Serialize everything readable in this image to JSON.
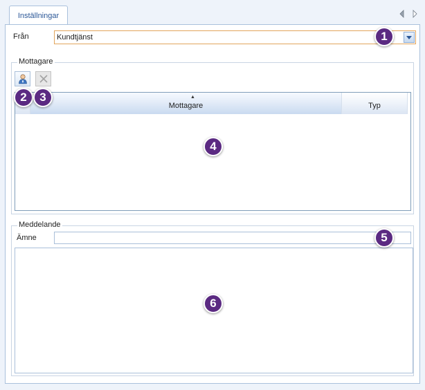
{
  "tab": {
    "label": "Inställningar"
  },
  "from": {
    "label": "Från",
    "value": "Kundtjänst"
  },
  "recipients_group": {
    "title": "Mottagare",
    "columns": [
      "Mottagare",
      "Typ"
    ]
  },
  "message_group": {
    "title": "Meddelande",
    "subject_label": "Ämne",
    "subject_value": "",
    "body_value": ""
  },
  "markers": [
    "1",
    "2",
    "3",
    "4",
    "5",
    "6"
  ],
  "colors": {
    "marker": "#5b2a82",
    "accent": "#2b5797",
    "combo_border": "#e2a55b"
  },
  "icons": [
    "prev-arrow-icon",
    "next-arrow-icon",
    "dropdown-arrow-icon",
    "add-recipient-icon",
    "remove-icon",
    "sort-ascending-icon"
  ]
}
